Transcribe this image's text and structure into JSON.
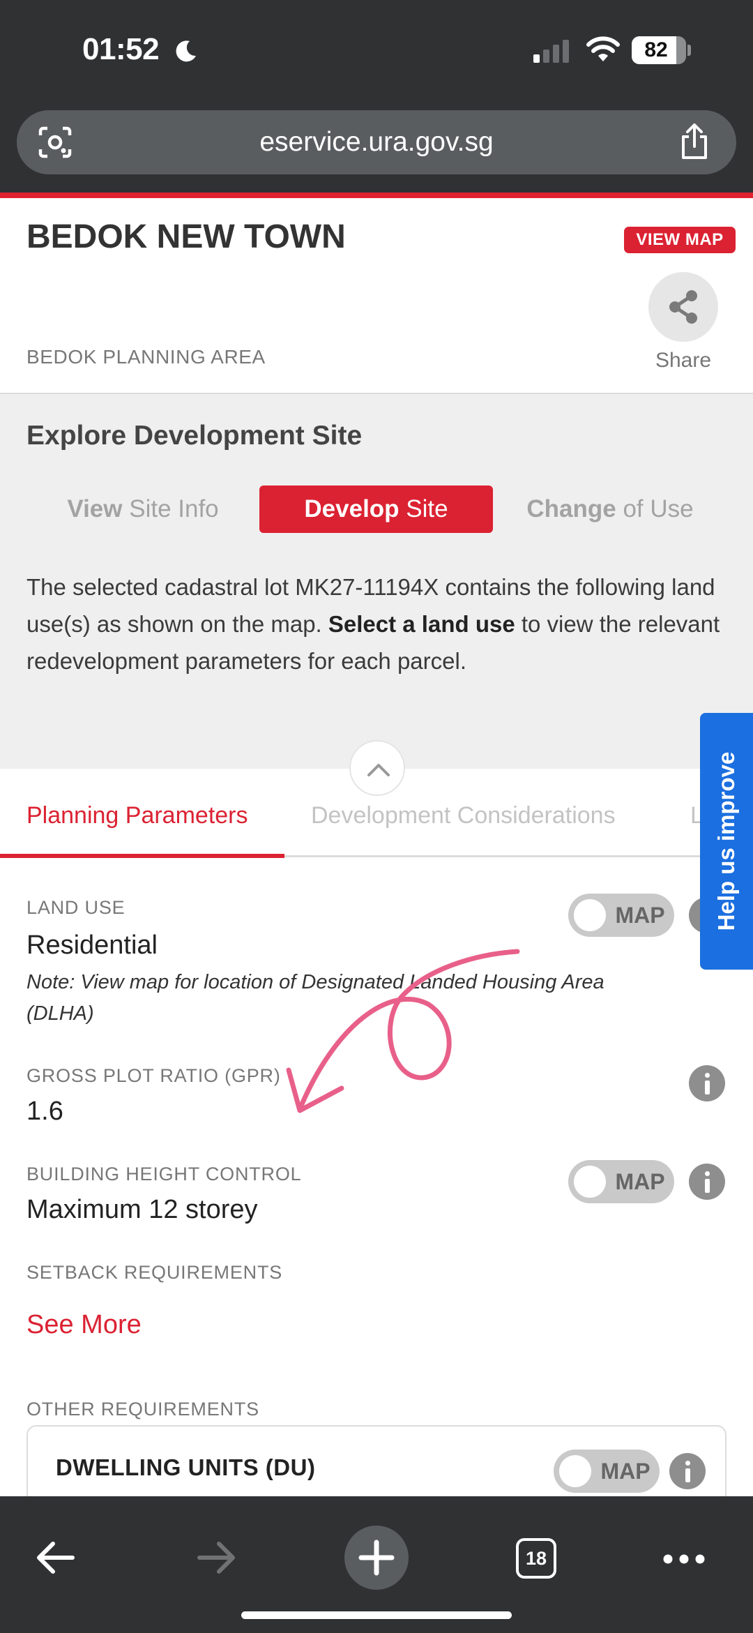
{
  "status_bar": {
    "time": "01:52",
    "battery": "82",
    "battery_level": 0.82,
    "icons": [
      "moon-icon",
      "cellular-signal-icon",
      "wifi-icon",
      "battery-icon"
    ]
  },
  "browser": {
    "url": "eservice.ura.gov.sg",
    "icons": [
      "lens-icon",
      "share-icon"
    ]
  },
  "header": {
    "title": "BEDOK NEW TOWN",
    "view_map": "VIEW MAP",
    "share_label": "Share",
    "planning_area": "BEDOK PLANNING AREA"
  },
  "explore": {
    "title": "Explore Development Site",
    "modes": [
      {
        "bold": "View",
        "rest": " Site Info",
        "active": false
      },
      {
        "bold": "Develop",
        "rest": " Site",
        "active": true
      },
      {
        "bold": "Change",
        "rest": " of Use",
        "active": false
      }
    ],
    "desc_part1": "The selected cadastral lot MK27-11194X contains the following land use(s) as shown on the map. ",
    "desc_bold": "Select a land use",
    "desc_part2": " to view the relevant redevelopment parameters for each parcel."
  },
  "tabs": [
    {
      "label": "Planning Parameters",
      "active": true
    },
    {
      "label": "Development Considerations",
      "active": false
    },
    {
      "label": "L",
      "active": false
    }
  ],
  "help_tab": "Help us improve",
  "parameters": {
    "land_use": {
      "label": "LAND USE",
      "value": "Residential",
      "note": "Note: View map for location of Designated Landed Housing Area (DLHA)"
    },
    "gpr": {
      "label": "GROSS PLOT RATIO (GPR)",
      "value": "1.6"
    },
    "height": {
      "label": "BUILDING HEIGHT CONTROL",
      "value": "Maximum 12 storey"
    },
    "setback": {
      "label": "SETBACK REQUIREMENTS",
      "link": "See More"
    },
    "other": {
      "label": "OTHER REQUIREMENTS",
      "card_title": "DWELLING UNITS (DU)"
    },
    "map_toggle_label": "MAP"
  },
  "toolbar": {
    "tab_count": "18",
    "icons": [
      "back-arrow-icon",
      "forward-arrow-icon",
      "plus-icon",
      "tabs-icon",
      "more-icon"
    ]
  },
  "colors": {
    "accent_red": "#db2232",
    "help_blue": "#1b6fe0",
    "chrome_dark": "#2f3133",
    "annotation_pink": "#e8608a"
  }
}
